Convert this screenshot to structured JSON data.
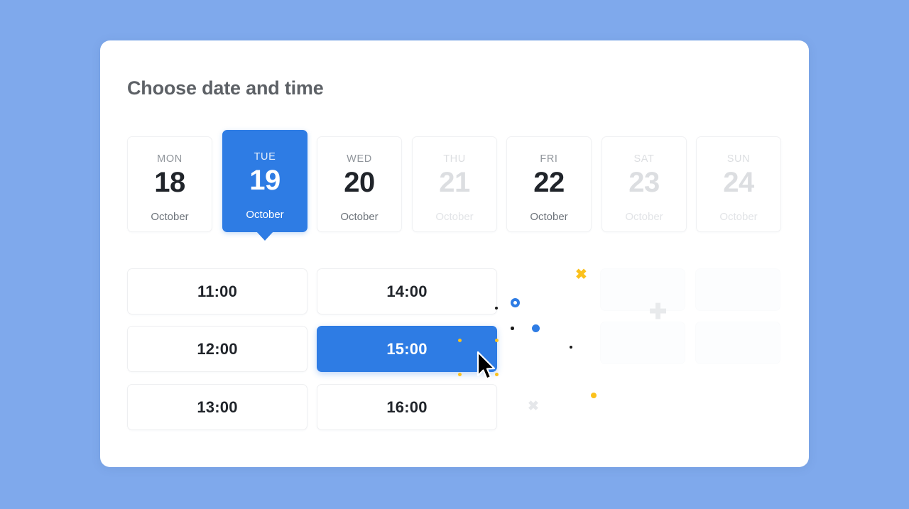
{
  "dialog": {
    "title": "Choose date and time"
  },
  "days": [
    {
      "dow": "MON",
      "num": "18",
      "month": "October",
      "state": "enabled"
    },
    {
      "dow": "TUE",
      "num": "19",
      "month": "October",
      "state": "selected"
    },
    {
      "dow": "WED",
      "num": "20",
      "month": "October",
      "state": "enabled"
    },
    {
      "dow": "THU",
      "num": "21",
      "month": "October",
      "state": "disabled"
    },
    {
      "dow": "FRI",
      "num": "22",
      "month": "October",
      "state": "enabled"
    },
    {
      "dow": "SAT",
      "num": "23",
      "month": "October",
      "state": "disabled"
    },
    {
      "dow": "SUN",
      "num": "24",
      "month": "October",
      "state": "disabled"
    }
  ],
  "times": [
    {
      "label": "11:00",
      "state": "enabled"
    },
    {
      "label": "14:00",
      "state": "enabled"
    },
    {
      "label": "12:00",
      "state": "enabled"
    },
    {
      "label": "15:00",
      "state": "selected"
    },
    {
      "label": "13:00",
      "state": "enabled"
    },
    {
      "label": "16:00",
      "state": "enabled"
    }
  ],
  "icons": {
    "calendar": "calendar-icon",
    "cursor": "mouse-pointer-icon",
    "particle_x_yellow": "x-mark-icon",
    "particle_x_gray": "x-mark-icon",
    "particle_plus_gray": "plus-icon"
  },
  "colors": {
    "page_background": "#7FA9EC",
    "card_background": "#FFFFFF",
    "accent_blue": "#2E7CE4",
    "accent_yellow": "#FBC11C",
    "text_primary": "#20242A",
    "text_muted": "#90959B",
    "text_disabled": "#DCDEE1",
    "title": "#5D6166",
    "border": "#EEEFF1"
  }
}
